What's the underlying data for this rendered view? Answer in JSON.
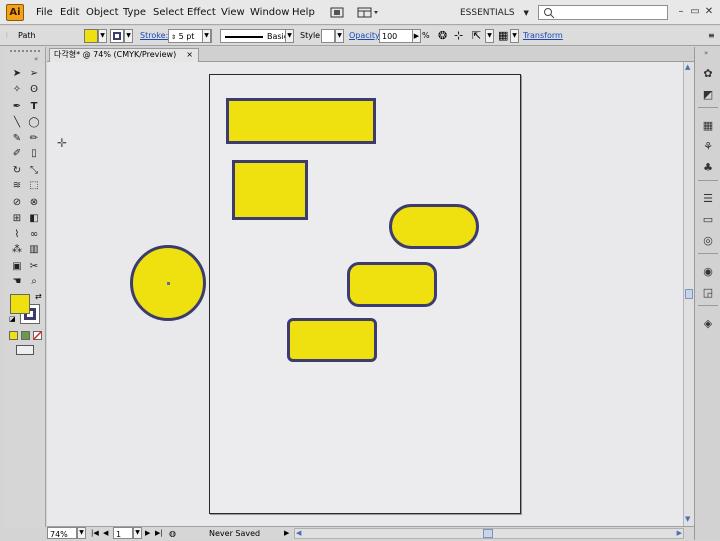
{
  "app": {
    "logo": "Ai"
  },
  "menu": [
    "File",
    "Edit",
    "Object",
    "Type",
    "Select",
    "Effect",
    "View",
    "Window",
    "Help"
  ],
  "workspace": "ESSENTIALS",
  "control_bar": {
    "selection_label": "Path",
    "stroke_label": "Stroke:",
    "stroke_weight": "5 pt",
    "brush_label": "Basic",
    "style_label": "Style:",
    "opacity_label": "Opacity:",
    "opacity_value": "100",
    "opacity_unit": "%",
    "transform_link": "Transform",
    "fill_color": "#efe10f",
    "stroke_color": "#3c3d6e"
  },
  "document_tab": {
    "title": "다각형* @ 74% (CMYK/Preview)",
    "close": "×"
  },
  "status_bar": {
    "zoom": "74%",
    "artboard": "1",
    "save_state": "Never Saved"
  },
  "colors": {
    "fill": "#efe10f",
    "stroke": "#3c3d6e"
  }
}
